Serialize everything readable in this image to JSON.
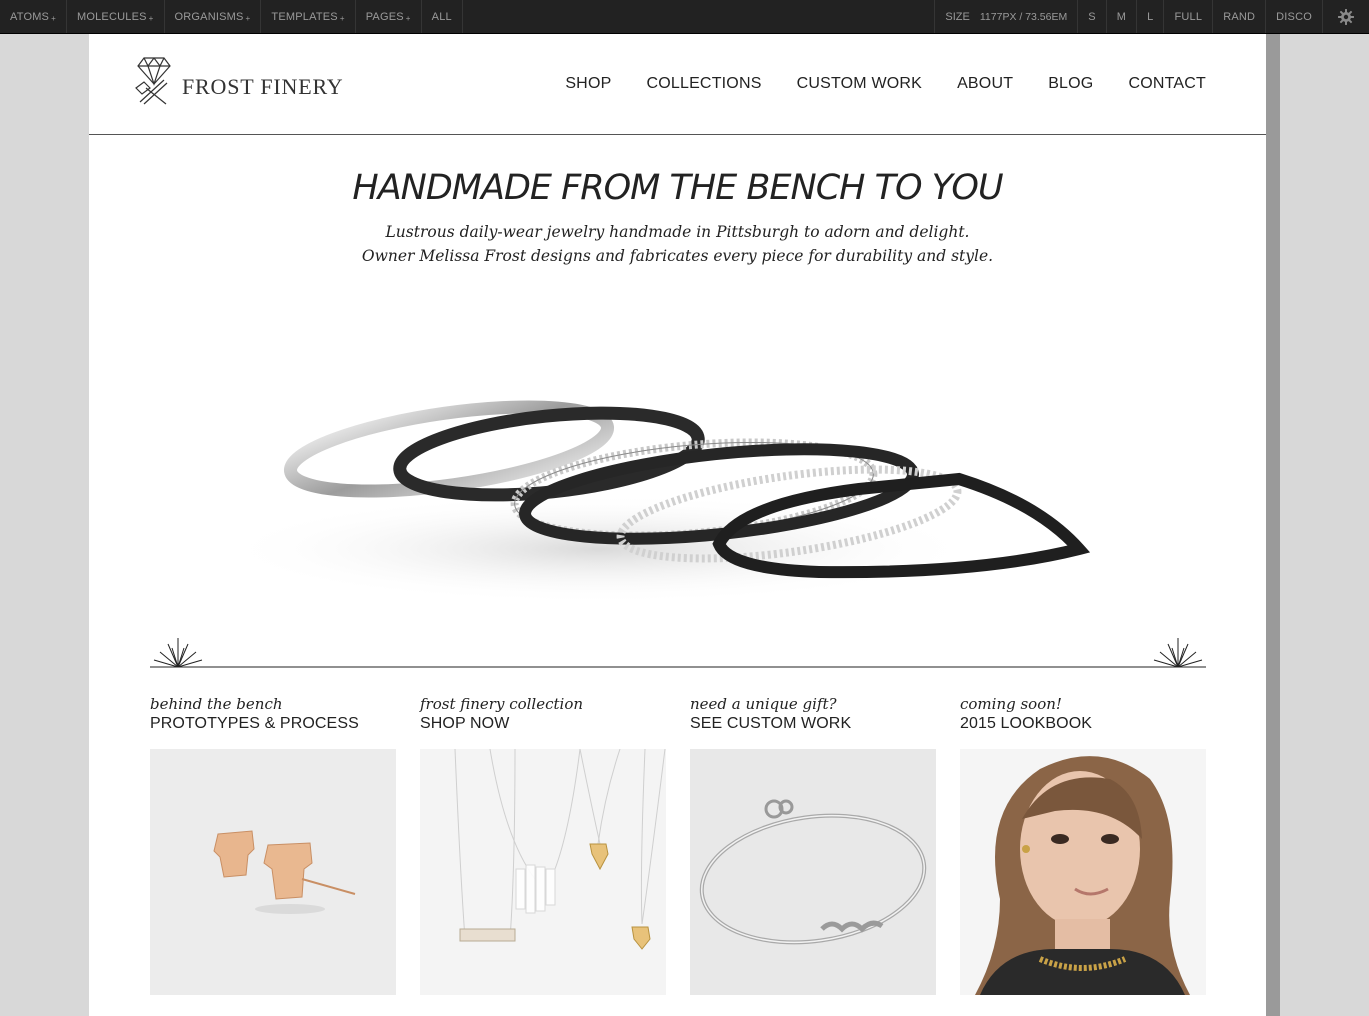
{
  "toolbar": {
    "menus": [
      {
        "label": "ATOMS",
        "plus": "+"
      },
      {
        "label": "MOLECULES",
        "plus": "+"
      },
      {
        "label": "ORGANISMS",
        "plus": "+"
      },
      {
        "label": "TEMPLATES",
        "plus": "+"
      },
      {
        "label": "PAGES",
        "plus": "+"
      },
      {
        "label": "ALL",
        "plus": ""
      }
    ],
    "size_label": "SIZE",
    "size_value": "1177PX / 73.56EM",
    "size_buttons": [
      "S",
      "M",
      "L",
      "FULL",
      "RAND",
      "DISCO"
    ],
    "settings_icon": "gear-icon"
  },
  "site": {
    "logo_text": "FROST FINERY",
    "logo_icon": "diamond-hammer-icon",
    "nav": [
      "SHOP",
      "COLLECTIONS",
      "CUSTOM WORK",
      "ABOUT",
      "BLOG",
      "CONTACT"
    ]
  },
  "hero": {
    "title": "HANDMADE FROM THE BENCH TO YOU",
    "text": "Lustrous daily-wear jewelry handmade in Pittsburgh to adorn and delight. Owner Melissa Frost designs and fabricates every piece for durability and style."
  },
  "cards": [
    {
      "kicker": "behind the bench",
      "title": "PROTOTYPES & PROCESS"
    },
    {
      "kicker": "frost finery collection",
      "title": "SHOP NOW"
    },
    {
      "kicker": "need a unique gift?",
      "title": "SEE CUSTOM WORK"
    },
    {
      "kicker": "coming soon!",
      "title": "2015 LOOKBOOK"
    }
  ],
  "colors": {
    "toolbar_bg": "#222222",
    "toolbar_text": "#9a9a9a",
    "text": "#222222",
    "page_bg": "#d8d8d8"
  }
}
